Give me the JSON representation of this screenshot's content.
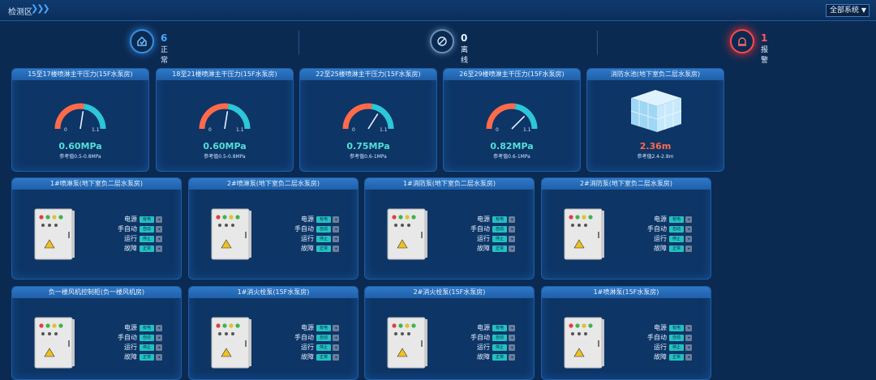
{
  "header": {
    "crumb": "检测区",
    "system_select": "全部系统"
  },
  "stats": [
    {
      "count": "6",
      "label": "正常",
      "color": "#4aa6ff"
    },
    {
      "count": "0",
      "label": "离线",
      "color": "#cfe6ff"
    },
    {
      "count": "1",
      "label": "报警",
      "color": "#ff5a5a"
    }
  ],
  "gauges": [
    {
      "title": "15至17楼喷淋主干压力(15F水泵房)",
      "value": "0.60MPa",
      "ref": "参考值0.5-0.8MPa",
      "min": "0",
      "max": "1.1",
      "fraction": 0.55
    },
    {
      "title": "18至21楼喷淋主干压力(15F水泵房)",
      "value": "0.60MPa",
      "ref": "参考值0.5-0.8MPa",
      "min": "0",
      "max": "1.1",
      "fraction": 0.55
    },
    {
      "title": "22至25楼喷淋主干压力(15F水泵房)",
      "value": "0.75MPa",
      "ref": "参考值0.6-1MPa",
      "min": "0",
      "max": "1.1",
      "fraction": 0.68
    },
    {
      "title": "26至29楼喷淋主干压力(15F水泵房)",
      "value": "0.82MPa",
      "ref": "参考值0.6-1MPa",
      "min": "0",
      "max": "1.1",
      "fraction": 0.75
    }
  ],
  "tank": {
    "title": "消防水池(地下室负二层水泵房)",
    "value": "2.36m",
    "ref": "参考值2.4-2.8m"
  },
  "status_labels": [
    "电源",
    "手自动",
    "运行",
    "故障"
  ],
  "cabinets": [
    {
      "title": "1#喷淋泵(地下室负二层水泵房)",
      "values": [
        "有电",
        "自动",
        "停止",
        "正常"
      ]
    },
    {
      "title": "2#喷淋泵(地下室负二层水泵房)",
      "values": [
        "有电",
        "自动",
        "停止",
        "正常"
      ]
    },
    {
      "title": "1#消防泵(地下室负二层水泵房)",
      "values": [
        "有电",
        "自动",
        "停止",
        "正常"
      ]
    },
    {
      "title": "2#消防泵(地下室负二层水泵房)",
      "values": [
        "有电",
        "自动",
        "停止",
        "正常"
      ]
    },
    {
      "title": "负一楼风机控制柜(负一楼风机房)",
      "values": [
        "有电",
        "自动",
        "停止",
        "正常"
      ]
    },
    {
      "title": "1#消火栓泵(15F水泵房)",
      "values": [
        "有电",
        "自动",
        "停止",
        "正常"
      ]
    },
    {
      "title": "2#消火栓泵(15F水泵房)",
      "values": [
        "有电",
        "自动",
        "停止",
        "正常"
      ]
    },
    {
      "title": "1#喷淋泵(15F水泵房)",
      "values": [
        "有电",
        "自动",
        "停止",
        "正常"
      ]
    }
  ]
}
